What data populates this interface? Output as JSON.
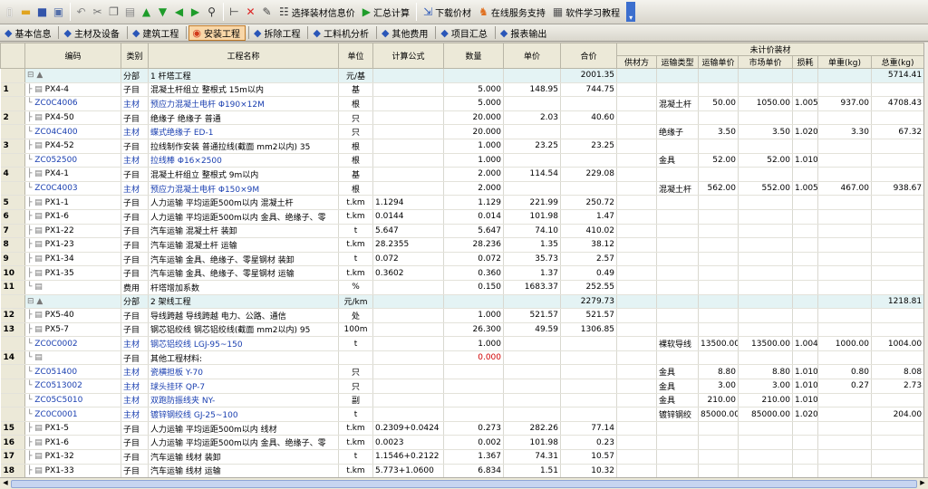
{
  "toolbar": {
    "select_text": "选择装材信息价",
    "summary_text": "汇总计算",
    "download_text": "下载价材",
    "online_text": "在线服务支持",
    "tutorial_text": "软件学习教程"
  },
  "tabs": [
    {
      "label": "基本信息"
    },
    {
      "label": "主材及设备"
    },
    {
      "label": "建筑工程"
    },
    {
      "label": "安装工程",
      "active": true
    },
    {
      "label": "拆除工程"
    },
    {
      "label": "工料机分析"
    },
    {
      "label": "其他费用"
    },
    {
      "label": "项目汇总"
    },
    {
      "label": "报表输出"
    }
  ],
  "grid": {
    "group_header": "未计价装材",
    "headers": [
      "编码",
      "类别",
      "工程名称",
      "单位",
      "计算公式",
      "数量",
      "单价",
      "合价",
      "供材方",
      "运输类型",
      "运输单价",
      "市场单价",
      "损耗",
      "单重(kg)",
      "总重(kg)"
    ],
    "rows": [
      {
        "rn": "",
        "sec": true,
        "code": "",
        "type": "分部",
        "name": "1 杆塔工程",
        "unit": "元/基",
        "formula": "",
        "qty": "",
        "price": "",
        "total": "2001.35",
        "sup": "",
        "trans": "",
        "tprice": "",
        "mprice": "",
        "loss": "",
        "uw": "",
        "tw": "5714.41"
      },
      {
        "rn": "1",
        "code": "PX4-4",
        "type": "子目",
        "name": "混凝土杆组立 整根式 15m以内",
        "unit": "基",
        "formula": "",
        "qty": "5.000",
        "price": "148.95",
        "total": "744.75",
        "sup": "",
        "trans": "",
        "tprice": "",
        "mprice": "",
        "loss": "",
        "uw": "",
        "tw": ""
      },
      {
        "rn": "",
        "mat": true,
        "code": "ZC0C4006",
        "type": "主材",
        "name": "预应力混凝土电杆 Φ190×12M",
        "unit": "根",
        "formula": "",
        "qty": "5.000",
        "price": "",
        "total": "",
        "sup": "",
        "trans": "混凝土杆",
        "tprice": "50.00",
        "mprice": "1050.00",
        "loss": "1.005",
        "uw": "937.00",
        "tw": "4708.43"
      },
      {
        "rn": "2",
        "code": "PX4-50",
        "type": "子目",
        "name": "绝缘子 绝缘子 普通",
        "unit": "只",
        "formula": "",
        "qty": "20.000",
        "price": "2.03",
        "total": "40.60",
        "sup": "",
        "trans": "",
        "tprice": "",
        "mprice": "",
        "loss": "",
        "uw": "",
        "tw": ""
      },
      {
        "rn": "",
        "mat": true,
        "code": "ZC04C400",
        "type": "主材",
        "name": "蝶式绝缘子 ED-1",
        "unit": "只",
        "formula": "",
        "qty": "20.000",
        "price": "",
        "total": "",
        "sup": "",
        "trans": "绝缘子",
        "tprice": "3.50",
        "mprice": "3.50",
        "loss": "1.020",
        "uw": "3.30",
        "tw": "67.32"
      },
      {
        "rn": "3",
        "code": "PX4-52",
        "type": "子目",
        "name": "拉线制作安装 普通拉线(截面 mm2以内) 35",
        "unit": "根",
        "formula": "",
        "qty": "1.000",
        "price": "23.25",
        "total": "23.25",
        "sup": "",
        "trans": "",
        "tprice": "",
        "mprice": "",
        "loss": "",
        "uw": "",
        "tw": ""
      },
      {
        "rn": "",
        "mat": true,
        "code": "ZC052500",
        "type": "主材",
        "name": "拉线棒 Φ16×2500",
        "unit": "根",
        "formula": "",
        "qty": "1.000",
        "price": "",
        "total": "",
        "sup": "",
        "trans": "金具",
        "tprice": "52.00",
        "mprice": "52.00",
        "loss": "1.010",
        "uw": "",
        "tw": ""
      },
      {
        "rn": "4",
        "code": "PX4-1",
        "type": "子目",
        "name": "混凝土杆组立 整根式 9m以内",
        "unit": "基",
        "formula": "",
        "qty": "2.000",
        "price": "114.54",
        "total": "229.08",
        "sup": "",
        "trans": "",
        "tprice": "",
        "mprice": "",
        "loss": "",
        "uw": "",
        "tw": ""
      },
      {
        "rn": "",
        "mat": true,
        "code": "ZC0C4003",
        "type": "主材",
        "name": "预应力混凝土电杆 Φ150×9M",
        "unit": "根",
        "formula": "",
        "qty": "2.000",
        "price": "",
        "total": "",
        "sup": "",
        "trans": "混凝土杆",
        "tprice": "562.00",
        "mprice": "552.00",
        "loss": "1.005",
        "uw": "467.00",
        "tw": "938.67"
      },
      {
        "rn": "5",
        "code": "PX1-1",
        "type": "子目",
        "name": "人力运输 平均运距500m以内 混凝土杆",
        "unit": "t.km",
        "formula": "1.1294",
        "qty": "1.129",
        "price": "221.99",
        "total": "250.72",
        "sup": "",
        "trans": "",
        "tprice": "",
        "mprice": "",
        "loss": "",
        "uw": "",
        "tw": ""
      },
      {
        "rn": "6",
        "code": "PX1-6",
        "type": "子目",
        "name": "人力运输 平均运距500m以内 金具、绝缘子、零",
        "unit": "t.km",
        "formula": "0.0144",
        "qty": "0.014",
        "price": "101.98",
        "total": "1.47",
        "sup": "",
        "trans": "",
        "tprice": "",
        "mprice": "",
        "loss": "",
        "uw": "",
        "tw": ""
      },
      {
        "rn": "7",
        "code": "PX1-22",
        "type": "子目",
        "name": "汽车运输 混凝土杆 装卸",
        "unit": "t",
        "formula": "5.647",
        "qty": "5.647",
        "price": "74.10",
        "total": "410.02",
        "sup": "",
        "trans": "",
        "tprice": "",
        "mprice": "",
        "loss": "",
        "uw": "",
        "tw": ""
      },
      {
        "rn": "8",
        "code": "PX1-23",
        "type": "子目",
        "name": "汽车运输 混凝土杆 运输",
        "unit": "t.km",
        "formula": "28.2355",
        "qty": "28.236",
        "price": "1.35",
        "total": "38.12",
        "sup": "",
        "trans": "",
        "tprice": "",
        "mprice": "",
        "loss": "",
        "uw": "",
        "tw": ""
      },
      {
        "rn": "9",
        "code": "PX1-34",
        "type": "子目",
        "name": "汽车运输 金具、绝缘子、零星钢材 装卸",
        "unit": "t",
        "formula": "0.072",
        "qty": "0.072",
        "price": "35.73",
        "total": "2.57",
        "sup": "",
        "trans": "",
        "tprice": "",
        "mprice": "",
        "loss": "",
        "uw": "",
        "tw": ""
      },
      {
        "rn": "10",
        "code": "PX1-35",
        "type": "子目",
        "name": "汽车运输 金具、绝缘子、零星钢材 运输",
        "unit": "t.km",
        "formula": "0.3602",
        "qty": "0.360",
        "price": "1.37",
        "total": "0.49",
        "sup": "",
        "trans": "",
        "tprice": "",
        "mprice": "",
        "loss": "",
        "uw": "",
        "tw": ""
      },
      {
        "rn": "11",
        "code": "",
        "type": "费用",
        "name": "杆塔增加系数",
        "unit": "%",
        "formula": "",
        "qty": "0.150",
        "price": "1683.37",
        "total": "252.55",
        "sup": "",
        "trans": "",
        "tprice": "",
        "mprice": "",
        "loss": "",
        "uw": "",
        "tw": ""
      },
      {
        "rn": "",
        "sec": true,
        "code": "",
        "type": "分部",
        "name": "2 架线工程",
        "unit": "元/km",
        "formula": "",
        "qty": "",
        "price": "",
        "total": "2279.73",
        "sup": "",
        "trans": "",
        "tprice": "",
        "mprice": "",
        "loss": "",
        "uw": "",
        "tw": "1218.81"
      },
      {
        "rn": "12",
        "code": "PX5-40",
        "type": "子目",
        "name": "导线跨越 导线跨越 电力、公路、通信",
        "unit": "处",
        "formula": "",
        "qty": "1.000",
        "price": "521.57",
        "total": "521.57",
        "sup": "",
        "trans": "",
        "tprice": "",
        "mprice": "",
        "loss": "",
        "uw": "",
        "tw": ""
      },
      {
        "rn": "13",
        "code": "PX5-7",
        "type": "子目",
        "name": "钢芯铝绞线 钢芯铝绞线(截面 mm2以内) 95",
        "unit": "100m",
        "formula": "",
        "qty": "26.300",
        "price": "49.59",
        "total": "1306.85",
        "sup": "",
        "trans": "",
        "tprice": "",
        "mprice": "",
        "loss": "",
        "uw": "",
        "tw": ""
      },
      {
        "rn": "",
        "mat": true,
        "code": "ZC0C0002",
        "type": "主材",
        "name": "钢芯铝绞线 LGJ-95~150",
        "unit": "t",
        "formula": "",
        "qty": "1.000",
        "price": "",
        "total": "",
        "sup": "",
        "trans": "裸软导线",
        "tprice": "13500.00",
        "mprice": "13500.00",
        "loss": "1.004",
        "uw": "1000.00",
        "tw": "1004.00"
      },
      {
        "rn": "14",
        "code": "",
        "type": "子目",
        "name": "其他工程材料:",
        "unit": "",
        "formula": "",
        "qty": "0.000",
        "price": "",
        "total": "",
        "sup": "",
        "trans": "",
        "tprice": "",
        "mprice": "",
        "loss": "",
        "uw": "",
        "tw": "",
        "red": true
      },
      {
        "rn": "",
        "mat": true,
        "code": "ZC051400",
        "type": "主材",
        "name": "瓷横担板 Y-70",
        "unit": "只",
        "formula": "",
        "qty": "",
        "price": "",
        "total": "",
        "sup": "",
        "trans": "金具",
        "tprice": "8.80",
        "mprice": "8.80",
        "loss": "1.010",
        "uw": "0.80",
        "tw": "8.08"
      },
      {
        "rn": "",
        "mat": true,
        "code": "ZC0513002",
        "type": "主材",
        "name": "球头挂环 QP-7",
        "unit": "只",
        "formula": "",
        "qty": "",
        "price": "",
        "total": "",
        "sup": "",
        "trans": "金具",
        "tprice": "3.00",
        "mprice": "3.00",
        "loss": "1.010",
        "uw": "0.27",
        "tw": "2.73"
      },
      {
        "rn": "",
        "mat": true,
        "code": "ZC05C5010",
        "type": "主材",
        "name": "双跑防振线夹 NY-",
        "unit": "副",
        "formula": "",
        "qty": "",
        "price": "",
        "total": "",
        "sup": "",
        "trans": "金具",
        "tprice": "210.00",
        "mprice": "210.00",
        "loss": "1.010",
        "uw": "",
        "tw": ""
      },
      {
        "rn": "",
        "mat": true,
        "code": "ZC0C0001",
        "type": "主材",
        "name": "镀锌钢绞线 GJ-25~100",
        "unit": "t",
        "formula": "",
        "qty": "",
        "price": "",
        "total": "",
        "sup": "",
        "trans": "镀锌钢绞",
        "tprice": "85000.00",
        "mprice": "85000.00",
        "loss": "1.020",
        "uw": "",
        "tw": "204.00"
      },
      {
        "rn": "15",
        "code": "PX1-5",
        "type": "子目",
        "name": "人力运输 平均运距500m以内 线材",
        "unit": "t.km",
        "formula": "0.2309+0.0424",
        "qty": "0.273",
        "price": "282.26",
        "total": "77.14",
        "sup": "",
        "trans": "",
        "tprice": "",
        "mprice": "",
        "loss": "",
        "uw": "",
        "tw": ""
      },
      {
        "rn": "16",
        "code": "PX1-6",
        "type": "子目",
        "name": "人力运输 平均运距500m以内 金具、绝缘子、零",
        "unit": "t.km",
        "formula": "0.0023",
        "qty": "0.002",
        "price": "101.98",
        "total": "0.23",
        "sup": "",
        "trans": "",
        "tprice": "",
        "mprice": "",
        "loss": "",
        "uw": "",
        "tw": ""
      },
      {
        "rn": "17",
        "code": "PX1-32",
        "type": "子目",
        "name": "汽车运输 线材 装卸",
        "unit": "t",
        "formula": "1.1546+0.2122",
        "qty": "1.367",
        "price": "74.31",
        "total": "10.57",
        "sup": "",
        "trans": "",
        "tprice": "",
        "mprice": "",
        "loss": "",
        "uw": "",
        "tw": ""
      },
      {
        "rn": "18",
        "code": "PX1-33",
        "type": "子目",
        "name": "汽车运输 线材 运输",
        "unit": "t.km",
        "formula": "5.773+1.0600",
        "qty": "6.834",
        "price": "1.51",
        "total": "10.32",
        "sup": "",
        "trans": "",
        "tprice": "",
        "mprice": "",
        "loss": "",
        "uw": "",
        "tw": ""
      }
    ]
  }
}
